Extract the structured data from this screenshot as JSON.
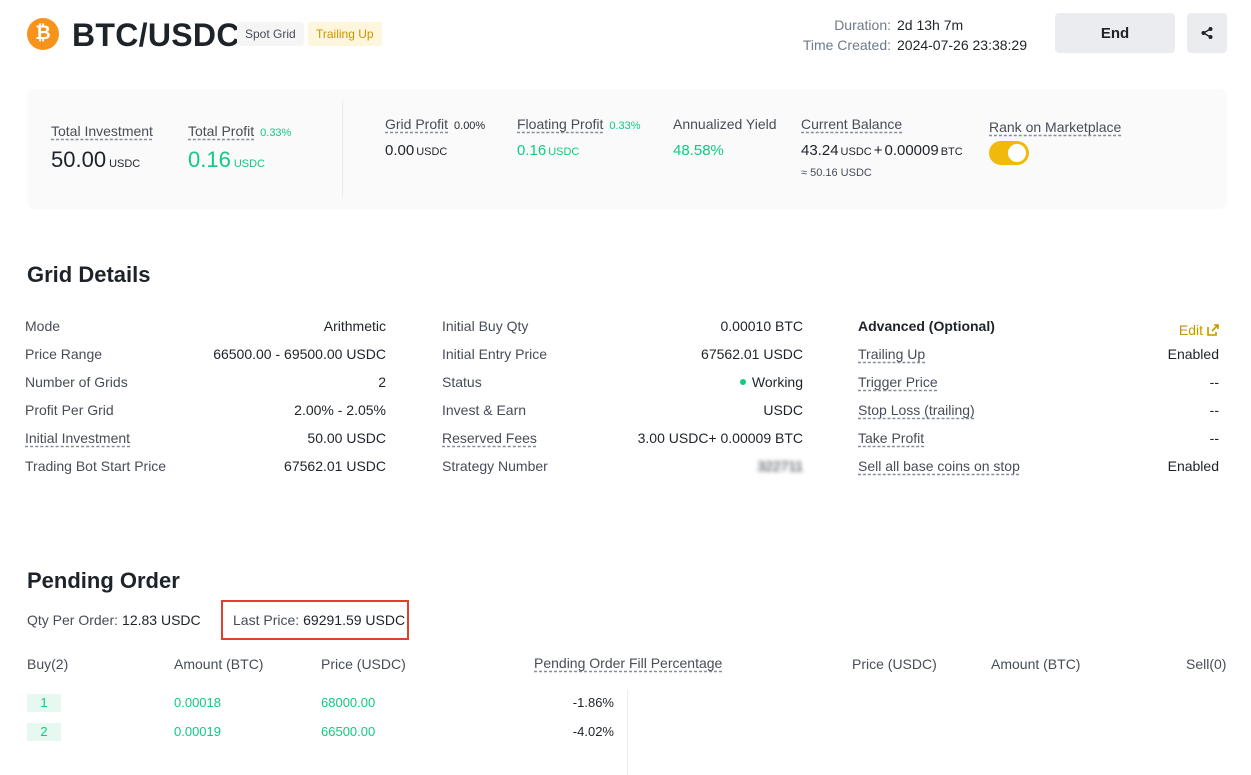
{
  "header": {
    "coin_symbol": "₿",
    "pair": "BTC/USDC",
    "tag_grid": "Spot Grid",
    "tag_trailing": "Trailing Up",
    "duration_label": "Duration:",
    "duration_value": "2d 13h 7m",
    "created_label": "Time Created:",
    "created_value": "2024-07-26 23:38:29",
    "end_label": "End",
    "share_icon": "share-icon"
  },
  "summary": {
    "total_investment_label": "Total Investment",
    "total_investment_value": "50.00",
    "total_investment_unit": "USDC",
    "total_profit_label": "Total Profit",
    "total_profit_pct": "0.33%",
    "total_profit_value": "0.16",
    "total_profit_unit": "USDC",
    "grid_profit_label": "Grid Profit",
    "grid_profit_pct": "0.00%",
    "grid_profit_value": "0.00",
    "grid_profit_unit": "USDC",
    "floating_profit_label": "Floating Profit",
    "floating_profit_pct": "0.33%",
    "floating_profit_value": "0.16",
    "floating_profit_unit": "USDC",
    "annualized_label": "Annualized Yield",
    "annualized_value": "48.58%",
    "balance_label": "Current Balance",
    "balance_usdc": "43.24",
    "balance_usdc_unit": "USDC",
    "balance_plus": "+",
    "balance_btc": "0.00009",
    "balance_btc_unit": "BTC",
    "balance_approx": "≈ 50.16 USDC",
    "rank_label": "Rank on Marketplace",
    "rank_enabled": true
  },
  "grid_details": {
    "title": "Grid Details",
    "col1": [
      {
        "key": "Mode",
        "value": "Arithmetic"
      },
      {
        "key": "Price Range",
        "value": "66500.00 - 69500.00 USDC"
      },
      {
        "key": "Number of Grids",
        "value": "2"
      },
      {
        "key": "Profit Per Grid",
        "value": "2.00% - 2.05%"
      },
      {
        "key": "Initial Investment",
        "value": "50.00 USDC"
      },
      {
        "key": "Trading Bot Start Price",
        "value": "67562.01 USDC"
      }
    ],
    "col2": [
      {
        "key": "Initial Buy Qty",
        "value": "0.00010 BTC"
      },
      {
        "key": "Initial Entry Price",
        "value": "67562.01 USDC"
      },
      {
        "key": "Status",
        "value": "Working"
      },
      {
        "key": "Invest & Earn",
        "value": "USDC"
      },
      {
        "key": "Reserved Fees",
        "value": "3.00 USDC+ 0.00009 BTC"
      },
      {
        "key": "Strategy Number",
        "value": "322711"
      }
    ],
    "advanced_title": "Advanced (Optional)",
    "edit_label": "Edit",
    "col3": [
      {
        "key": "Trailing Up",
        "value": "Enabled"
      },
      {
        "key": "Trigger Price",
        "value": "--"
      },
      {
        "key": "Stop Loss (trailing)",
        "value": "--"
      },
      {
        "key": "Take Profit",
        "value": "--"
      },
      {
        "key": "Sell all base coins on stop",
        "value": "Enabled"
      }
    ]
  },
  "pending": {
    "title": "Pending Order",
    "qty_label": "Qty Per Order:",
    "qty_value": "12.83 USDC",
    "last_price_label": "Last Price:",
    "last_price_value": "69291.59 USDC",
    "headers": {
      "buy": "Buy(2)",
      "amount_left": "Amount (BTC)",
      "price_left": "Price (USDC)",
      "fill_pct": "Pending Order Fill Percentage",
      "price_right": "Price (USDC)",
      "amount_right": "Amount (BTC)",
      "sell": "Sell(0)"
    },
    "buy_rows": [
      {
        "index": "1",
        "amount": "0.00018",
        "price": "68000.00",
        "fill": "-1.86%"
      },
      {
        "index": "2",
        "amount": "0.00019",
        "price": "66500.00",
        "fill": "-4.02%"
      }
    ]
  },
  "colors": {
    "accent": "#f0b90b",
    "green": "#0ecb81",
    "highlight_border": "#e33e2b",
    "bitcoin": "#f7931a"
  }
}
